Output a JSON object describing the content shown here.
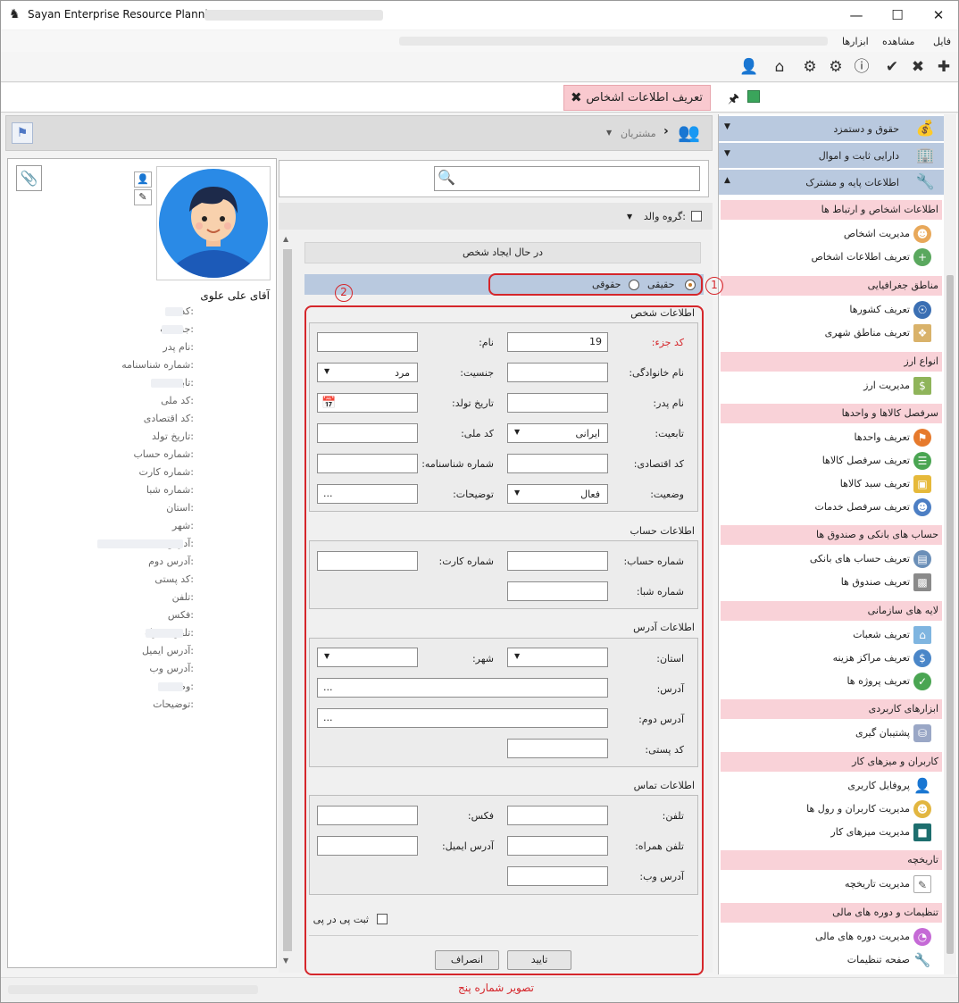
{
  "app_title": "Sayan Enterprise Resource Planning",
  "menu": [
    "فایل",
    "مشاهده",
    "ابزارها"
  ],
  "tab": {
    "label": "تعریف اطلاعات اشخاص"
  },
  "breadcrumb": {
    "label": "مشتریان"
  },
  "nav": {
    "accordions": [
      {
        "label": "حقوق و دستمزد",
        "icon": "payroll-icon"
      },
      {
        "label": "دارایی ثابت و اموال",
        "icon": "building-icon"
      },
      {
        "label": "اطلاعات پایه و مشترک",
        "icon": "tools-icon"
      }
    ],
    "groups": [
      {
        "label": "اطلاعات اشخاص و ارتباط ها",
        "items": [
          "مدیریت اشخاص",
          "تعریف اطلاعات اشخاص"
        ]
      },
      {
        "label": "مناطق جغرافیایی",
        "items": [
          "تعریف کشورها",
          "تعریف مناطق شهری"
        ]
      },
      {
        "label": "انواع ارز",
        "items": [
          "مدیریت ارز"
        ]
      },
      {
        "label": "سرفصل کالاها و واحدها",
        "items": [
          "تعریف واحدها",
          "تعریف سرفصل کالاها",
          "تعریف سبد کالاها",
          "تعریف سرفصل خدمات"
        ]
      },
      {
        "label": "حساب های بانکی و صندوق ها",
        "items": [
          "تعریف حساب های بانکی",
          "تعریف صندوق ها"
        ]
      },
      {
        "label": "لایه های سازمانی",
        "items": [
          "تعریف شعبات",
          "تعریف مراکز هزینه",
          "تعریف پروژه ها"
        ]
      },
      {
        "label": "ابزارهای کاربردی",
        "items": [
          "پشتیبان گیری"
        ]
      },
      {
        "label": "کاربران و میزهای کار",
        "items": [
          "پروفایل کاربری",
          "مدیریت کاربران و رول ها",
          "مدیریت میزهای کار"
        ]
      },
      {
        "label": "تاریخچه",
        "items": [
          "مدیریت تاریخچه"
        ]
      },
      {
        "label": "تنظیمات و دوره های مالی",
        "items": [
          "مدیریت دوره های مالی",
          "صفحه تنظیمات"
        ]
      }
    ]
  },
  "profile": {
    "name": "آقای علی علوی",
    "fields": [
      "کد:",
      "جنسیت:",
      "نام پدر:",
      "شماره شناسنامه:",
      "تابعیت:",
      "کد ملی:",
      "کد اقتصادی:",
      "تاریخ تولد:",
      "شماره حساب:",
      "شماره کارت:",
      "شماره شبا:",
      "استان:",
      "شهر:",
      "آدرس:",
      "آدرس دوم:",
      "کد پستی:",
      "تلفن:",
      "فکس:",
      "تلفن همراه:",
      "آدرس ایمیل:",
      "آدرس وب:",
      "وضعیت:",
      "توضیحات:"
    ]
  },
  "form": {
    "parent_group_label": "گروه والد:",
    "status_text": "در حال ایجاد شخص",
    "radio_real": "حقیقی",
    "radio_legal": "حقوقی",
    "marker1": "1",
    "marker2": "2",
    "person_section": "اطلاعات شخص",
    "code_label": "کد جزء:",
    "code_value": "19",
    "name_label": "نام:",
    "family_label": "نام خانوادگی:",
    "gender_label": "جنسیت:",
    "gender_value": "مرد",
    "father_label": "نام پدر:",
    "birth_label": "تاریخ تولد:",
    "nationality_label": "تابعیت:",
    "nationality_value": "ایرانی",
    "national_code_label": "کد ملی:",
    "economic_label": "کد اقتصادی:",
    "idnum_label": "شماره شناسنامه:",
    "status_label": "وضعیت:",
    "status_value": "فعال",
    "desc_label": "توضیحات:",
    "desc_value": "...",
    "account_section": "اطلاعات حساب",
    "account_label": "شماره حساب:",
    "card_label": "شماره کارت:",
    "sheba_label": "شماره شبا:",
    "address_section": "اطلاعات آدرس",
    "province_label": "استان:",
    "city_label": "شهر:",
    "address_label": "آدرس:",
    "address_value": "...",
    "address2_label": "آدرس دوم:",
    "address2_value": "...",
    "postal_label": "کد پستی:",
    "contact_section": "اطلاعات تماس",
    "phone_label": "تلفن:",
    "fax_label": "فکس:",
    "mobile_label": "تلفن همراه:",
    "email_label": "آدرس ایمیل:",
    "web_label": "آدرس وب:",
    "continuous_label": "ثبت پی در پی",
    "ok_button": "تایید",
    "cancel_button": "انصراف"
  },
  "caption": "تصویر شماره پنج",
  "colors": {
    "accent_red": "#d5262b",
    "nav_blue": "#b9c9df",
    "nav_pink": "#f9d2d8",
    "tab_pink": "#f9c9cf"
  }
}
